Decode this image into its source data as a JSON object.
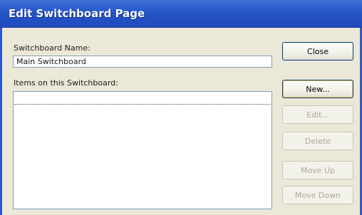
{
  "window": {
    "title": "Edit Switchboard Page"
  },
  "switchboard_name": {
    "label": "Switchboard Name:",
    "value": "Main Switchboard"
  },
  "items": {
    "label": "Items on this Switchboard:",
    "rows": [
      ""
    ]
  },
  "buttons": {
    "close": "Close",
    "new": "New...",
    "edit": "Edit...",
    "delete": "Delete",
    "move_up": "Move Up",
    "move_down": "Move Down"
  }
}
